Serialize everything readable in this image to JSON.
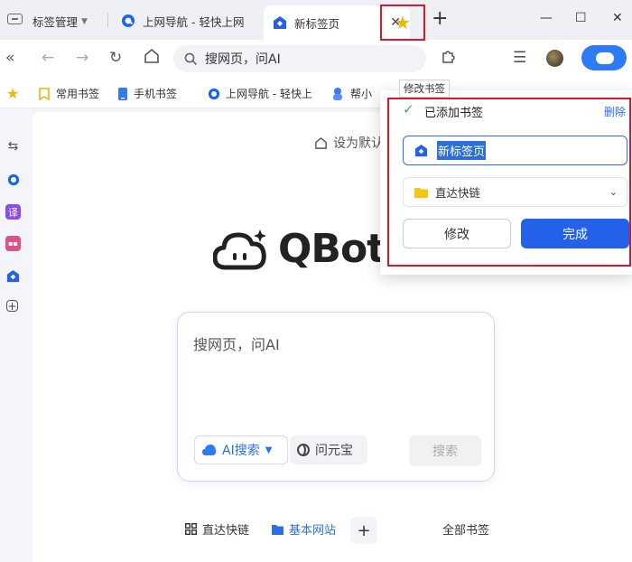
{
  "tabs": {
    "manager_label": "标签管理",
    "items": [
      {
        "title": "上网导航 - 轻快上网"
      },
      {
        "title": "新标签页"
      }
    ],
    "close_glyph": "✕",
    "new_tab_glyph": "+"
  },
  "window": {
    "minimize": "—",
    "maximize": "☐",
    "close": "✕"
  },
  "toolbar": {
    "address_text": "搜网页，问AI"
  },
  "bookmarks_bar": [
    {
      "label": "常用书签"
    },
    {
      "label": "手机书签"
    },
    {
      "label": "上网导航 - 轻快上"
    },
    {
      "label": "帮小"
    }
  ],
  "tooltip": "修改书签",
  "bookmark_popup": {
    "status": "已添加书签",
    "delete": "删除",
    "name_value": "新标签页",
    "folder": "直达快链",
    "edit_button": "修改",
    "done_button": "完成"
  },
  "main": {
    "set_default": "设为默认",
    "logo_text": "QBot",
    "search_placeholder": "搜网页，问AI",
    "ai_search": "AI搜索",
    "yuanbao": "问元宝",
    "search_button": "搜索",
    "bottom_nav": {
      "quick_links": "直达快链",
      "basic_sites": "基本网站",
      "all_bookmarks": "全部书签"
    }
  },
  "colors": {
    "accent": "#2362e8",
    "highlight_frame": "#d9192b",
    "star": "#f2b400"
  }
}
